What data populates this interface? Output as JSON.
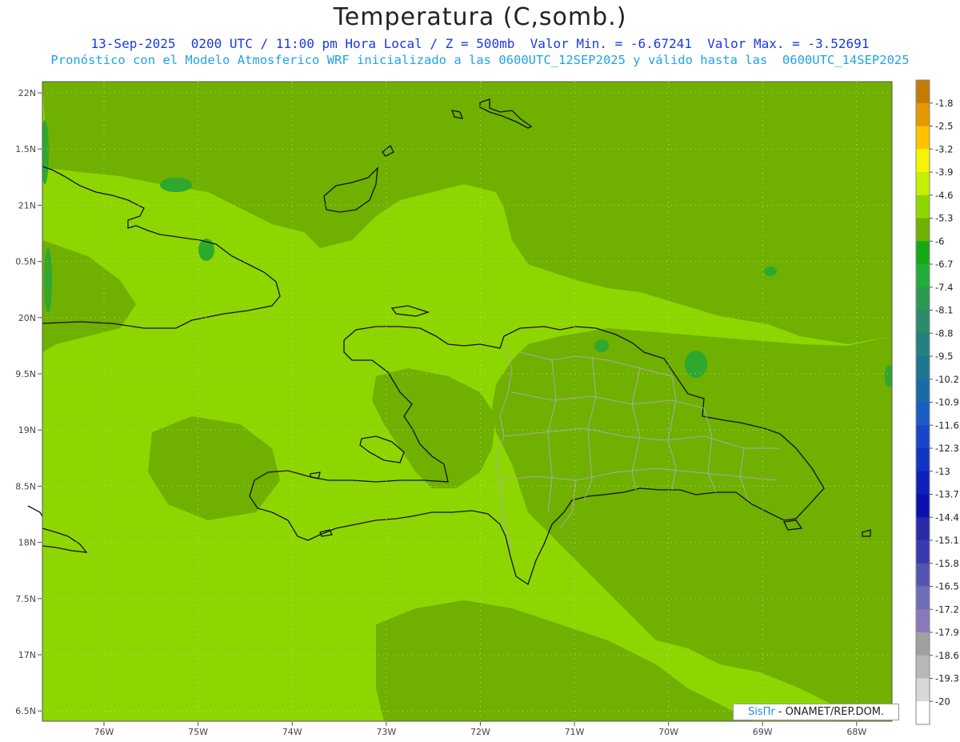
{
  "header": {
    "title": "Temperatura (C,somb.)",
    "line1": "13-Sep-2025  0200 UTC / 11:00 pm Hora Local / Z = 500mb  Valor Min. = -6.67241  Valor Max. = -3.52691",
    "line2": "Pronóstico con el Modelo Atmosferico WRF inicializado a las 0600UTC_12SEP2025 y válido hasta las  0600UTC_14SEP2025"
  },
  "map": {
    "lat_labels": [
      "22N",
      "1.5N",
      "21N",
      "0.5N",
      "20N",
      "9.5N",
      "19N",
      "8.5N",
      "18N",
      "7.5N",
      "17N",
      "6.5N"
    ],
    "lon_labels": [
      "76W",
      "75W",
      "74W",
      "73W",
      "72W",
      "71W",
      "70W",
      "69W",
      "68W"
    ],
    "colors": {
      "base": "#8ed600",
      "darker": "#6fb000",
      "darkest": "#2ea82e",
      "coast": "#111111",
      "provinces": "#aaaaaa"
    }
  },
  "colorbar": {
    "labels": [
      "-1.8",
      "-2.5",
      "-3.2",
      "-3.9",
      "-4.6",
      "-5.3",
      "-6",
      "-6.7",
      "-7.4",
      "-8.1",
      "-8.8",
      "-9.5",
      "-10.2",
      "-10.9",
      "-11.6",
      "-12.3",
      "-13",
      "-13.7",
      "-14.4",
      "-15.1",
      "-15.8",
      "-16.5",
      "-17.2",
      "-17.9",
      "-18.6",
      "-19.3",
      "-20"
    ],
    "colors": [
      "#c27d00",
      "#e39a00",
      "#ffc100",
      "#f5f500",
      "#c5f000",
      "#8ed600",
      "#6fb000",
      "#16a816",
      "#22ad3a",
      "#2a9a52",
      "#2a8a6a",
      "#23807e",
      "#1c7690",
      "#1a6aa8",
      "#1a5cc0",
      "#1846c8",
      "#1234c2",
      "#0e20b8",
      "#0c10b0",
      "#2a2aa8",
      "#3a3ab0",
      "#5454b2",
      "#6e6eb8",
      "#8a78b8",
      "#a0a0a0",
      "#b8b8b8",
      "#d8d8d8",
      "#ffffff"
    ]
  },
  "credit": {
    "brand": "SisПr",
    "text": "- ONAMET/REP.DOM."
  }
}
